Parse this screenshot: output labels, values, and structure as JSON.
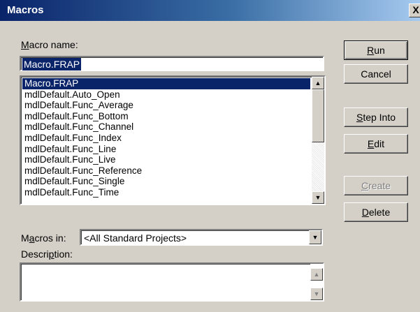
{
  "window": {
    "title": "Macros",
    "close_label": "X"
  },
  "macro_name": {
    "label_key": "M",
    "label_rest": "acro name:",
    "value": "Macro.FRAP"
  },
  "macro_list": {
    "items": [
      "Macro.FRAP",
      "mdlDefault.Auto_Open",
      "mdlDefault.Func_Average",
      "mdlDefault.Func_Bottom",
      "mdlDefault.Func_Channel",
      "mdlDefault.Func_Index",
      "mdlDefault.Func_Line",
      "mdlDefault.Func_Live",
      "mdlDefault.Func_Reference",
      "mdlDefault.Func_Single",
      "mdlDefault.Func_Time"
    ],
    "selected_index": 0
  },
  "buttons": {
    "run": {
      "key": "R",
      "rest": "un"
    },
    "cancel": {
      "label": "Cancel"
    },
    "step_into": {
      "key": "S",
      "rest": "tep Into"
    },
    "edit": {
      "key": "E",
      "rest": "dit"
    },
    "create": {
      "key": "C",
      "rest": "reate"
    },
    "delete": {
      "key": "D",
      "rest": "elete"
    }
  },
  "macros_in": {
    "label_pre": "M",
    "label_key": "a",
    "label_rest": "cros in:",
    "value": "<All Standard Projects>"
  },
  "description": {
    "label_pre": "Descri",
    "label_key": "p",
    "label_rest": "tion:",
    "value": ""
  },
  "icons": {
    "scroll_up": "up-arrow-icon",
    "scroll_down": "down-arrow-icon",
    "dropdown": "chevron-down-icon"
  }
}
